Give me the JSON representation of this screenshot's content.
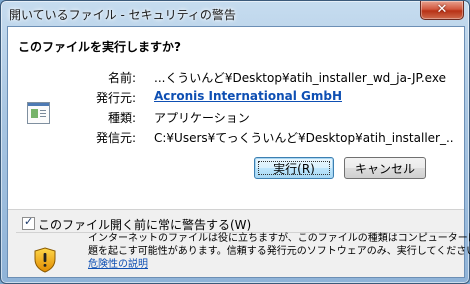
{
  "window": {
    "title": "開いているファイル - セキュリティの警告",
    "close_glyph": "✕"
  },
  "dialog": {
    "question": "このファイルを実行しますか?",
    "fields": [
      {
        "label": "名前:",
        "value": "...くういんど¥Desktop¥atih_installer_wd_ja-JP.exe"
      },
      {
        "label": "発行元:",
        "value": "Acronis International GmbH"
      },
      {
        "label": "種類:",
        "value": "アプリケーション"
      },
      {
        "label": "発信元:",
        "value": "C:¥Users¥てっくういんど¥Desktop¥atih_installer_..."
      }
    ],
    "file_icon": "application-window-icon"
  },
  "buttons": {
    "run": "実行(R)",
    "cancel": "キャンセル"
  },
  "checkbox": {
    "label": "このファイル開く前に常に警告する(W)",
    "checked": true,
    "check_glyph": "✓"
  },
  "warning": {
    "icon": "shield-warning-icon",
    "line1": "インターネットのファイルは役に立ちますが、このファイルの種類はコンピューターに問",
    "line2": "題を起こす可能性があります。信頼する発行元のソフトウェアのみ、実行してください。",
    "link": "危険性の説明"
  },
  "colors": {
    "accent_link": "#0e4fb3",
    "close_button": "#c8472d",
    "frame": "#a9c6e2"
  }
}
